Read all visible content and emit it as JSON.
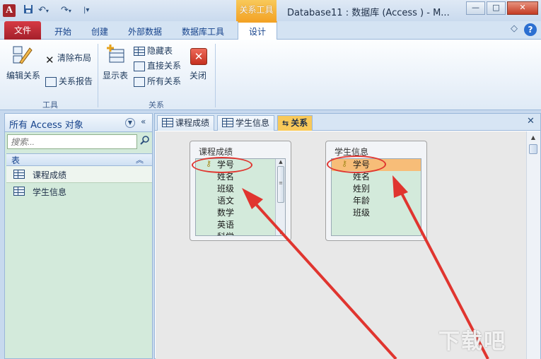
{
  "titlebar": {
    "app_logo": "A",
    "quick_access": [
      "save-icon",
      "undo-icon",
      "redo-icon",
      "customize-icon"
    ],
    "contextual_group": "关系工具",
    "window_title": "Database11 : 数据库 (Access        ) - M...",
    "min": "—",
    "max": "□",
    "close": "✕"
  },
  "ribbon_tabs": {
    "file": "文件",
    "tabs": [
      "开始",
      "创建",
      "外部数据",
      "数据库工具"
    ],
    "design": "设计",
    "collapse": "◇"
  },
  "ribbon": {
    "tools_group": {
      "label": "工具",
      "edit_relations": "编辑关系",
      "clear_layout": "清除布局",
      "relation_report": "关系报告"
    },
    "relations_group": {
      "label": "关系",
      "show_table": "显示表",
      "hide_table": "隐藏表",
      "direct_relations": "直接关系",
      "all_relations": "所有关系",
      "close": "关闭"
    }
  },
  "nav": {
    "title": "所有 Access 对象",
    "search_placeholder": "搜索...",
    "section": "表",
    "items": [
      {
        "label": "课程成绩",
        "selected": true
      },
      {
        "label": "学生信息",
        "selected": false
      }
    ]
  },
  "doc_tabs": {
    "tabs": [
      {
        "label": "课程成绩"
      },
      {
        "label": "学生信息"
      },
      {
        "label": "关系"
      }
    ],
    "close": "✕"
  },
  "tables": [
    {
      "title": "课程成绩",
      "fields": [
        "学号",
        "姓名",
        "班级",
        "语文",
        "数学",
        "英语",
        "科学"
      ],
      "key_field": "学号"
    },
    {
      "title": "学生信息",
      "fields": [
        "学号",
        "姓名",
        "姓别",
        "年龄",
        "班级"
      ],
      "key_field": "学号",
      "selected_field": "学号"
    }
  ],
  "colors": {
    "annotation": "#e0352f",
    "highlight": "#f7bd78",
    "nav_background": "#d3eadb",
    "contextual": "#f3a326"
  },
  "watermark": "下载吧"
}
